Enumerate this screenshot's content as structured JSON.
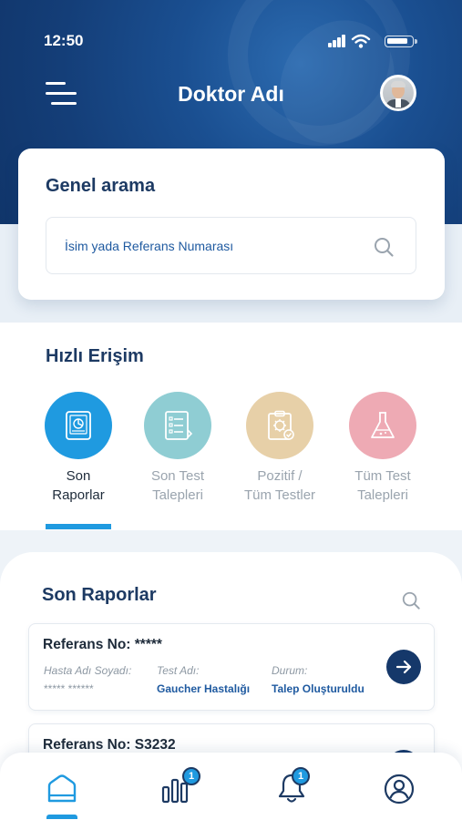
{
  "status_bar": {
    "time": "12:50"
  },
  "header": {
    "title": "Doktor Adı"
  },
  "search": {
    "title": "Genel arama",
    "placeholder": "İsim yada Referans Numarası"
  },
  "quick_access": {
    "title": "Hızlı Erişim",
    "items": [
      {
        "line1": "Son",
        "line2": "Raporlar",
        "color": "#1f9ae0",
        "active": true
      },
      {
        "line1": "Son Test",
        "line2": "Talepleri",
        "color": "#8fcdd3",
        "active": false
      },
      {
        "line1": "Pozitif /",
        "line2": "Tüm Testler",
        "color": "#e7d0a8",
        "active": false
      },
      {
        "line1": "Tüm Test",
        "line2": "Talepleri",
        "color": "#eeaab4",
        "active": false
      }
    ]
  },
  "reports": {
    "title": "Son Raporlar",
    "columns": {
      "patient": "Hasta Adı Soyadı:",
      "test": "Test Adı:",
      "status": "Durum:"
    },
    "items": [
      {
        "ref": "Referans No: *****",
        "patient": "***** ******",
        "test": "Gaucher Hastalığı",
        "status": "Talep Oluşturuldu"
      },
      {
        "ref": "Referans No: S3232"
      }
    ]
  },
  "bottom_nav": {
    "stats_badge": "1",
    "notifications_badge": "1"
  },
  "colors": {
    "primary_dark": "#15386a",
    "accent": "#1f9ae0",
    "title": "#1d3a63"
  }
}
